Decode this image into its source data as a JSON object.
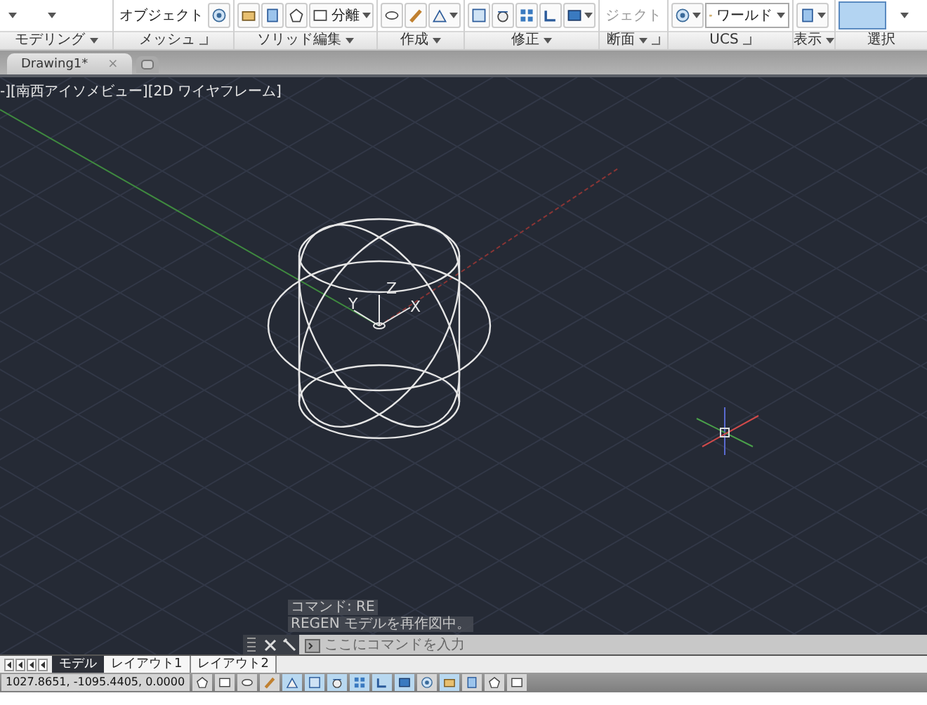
{
  "ribbon": {
    "panels": [
      {
        "label": "モデリング",
        "dropdown": true,
        "launcher": false,
        "tools": [
          {
            "kind": "caret"
          },
          {
            "kind": "caret"
          }
        ]
      },
      {
        "label": "メッシュ",
        "dropdown": false,
        "launcher": true,
        "tools": [
          {
            "kind": "text",
            "label": "オブジェクト",
            "disabled": false
          },
          {
            "kind": "icon"
          }
        ]
      },
      {
        "label": "ソリッド編集",
        "dropdown": true,
        "launcher": false,
        "tools": [
          {
            "kind": "icon"
          },
          {
            "kind": "icon"
          },
          {
            "kind": "icon"
          },
          {
            "kind": "split",
            "label": "分離"
          }
        ]
      },
      {
        "label": "作成",
        "dropdown": true,
        "launcher": false,
        "tools": [
          {
            "kind": "icon"
          },
          {
            "kind": "icon"
          },
          {
            "kind": "icon-dropdown"
          }
        ]
      },
      {
        "label": "修正",
        "dropdown": true,
        "launcher": false,
        "tools": [
          {
            "kind": "icon"
          },
          {
            "kind": "icon"
          },
          {
            "kind": "icon"
          },
          {
            "kind": "icon"
          },
          {
            "kind": "icon-dropdown"
          }
        ]
      },
      {
        "label": "断面",
        "dropdown": true,
        "launcher": true,
        "tools": [
          {
            "kind": "text",
            "label": "ジェクト",
            "disabled": true
          }
        ]
      },
      {
        "label": "UCS",
        "dropdown": false,
        "launcher": true,
        "tools": [
          {
            "kind": "icon-dropdown"
          },
          {
            "kind": "combo",
            "label": "ワールド"
          }
        ]
      },
      {
        "label": "表示",
        "dropdown": true,
        "launcher": false,
        "tools": [
          {
            "kind": "icon-dropdown"
          }
        ]
      },
      {
        "label": "選択",
        "dropdown": false,
        "launcher": false,
        "tools": [
          {
            "kind": "swatch"
          },
          {
            "kind": "caret"
          }
        ]
      }
    ]
  },
  "document_tabs": [
    {
      "label": "Drawing1*",
      "close": "×",
      "selected": true
    }
  ],
  "viewport": {
    "label": "-][南西アイソメビュー][2D ワイヤフレーム]",
    "ucs": {
      "x": "X",
      "y": "Y",
      "z": "Z"
    }
  },
  "command_history": [
    "コマンド: RE",
    "REGEN モデルを再作図中。"
  ],
  "command_line": {
    "placeholder": "ここにコマンドを入力"
  },
  "layout_tabs": [
    {
      "label": "モデル",
      "selected": true
    },
    {
      "label": "レイアウト1",
      "selected": false
    },
    {
      "label": "レイアウト2",
      "selected": false
    }
  ],
  "status_bar": {
    "coordinates": "1027.8651, -1095.4405, 0.0000",
    "toggles": [
      {
        "on": false
      },
      {
        "on": false
      },
      {
        "on": false
      },
      {
        "on": false
      },
      {
        "on": true
      },
      {
        "on": true
      },
      {
        "on": true
      },
      {
        "on": true
      },
      {
        "on": true
      },
      {
        "on": true
      },
      {
        "on": false
      },
      {
        "on": true
      },
      {
        "on": false
      },
      {
        "on": false
      },
      {
        "on": false
      }
    ]
  }
}
